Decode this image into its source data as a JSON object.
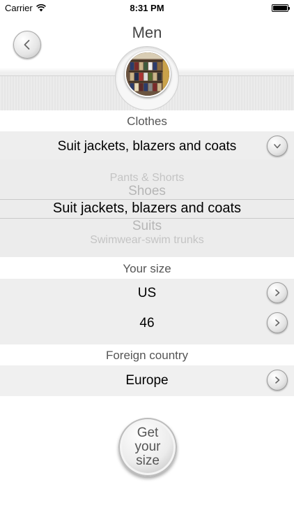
{
  "status_bar": {
    "carrier": "Carrier",
    "time": "8:31 PM",
    "battery_level": 1.0
  },
  "header": {
    "title": "Men"
  },
  "clothes_section": {
    "label": "Clothes",
    "selected": "Suit jackets, blazers and coats",
    "picker_options": [
      "Pants & Shorts",
      "Shoes",
      "Suit jackets, blazers and coats",
      "Suits",
      "Swimwear-swim trunks"
    ]
  },
  "size_section": {
    "label": "Your size",
    "system": "US",
    "value": "46"
  },
  "country_section": {
    "label": "Foreign country",
    "value": "Europe"
  },
  "get_size_button": {
    "line1": "Get",
    "line2": "your",
    "line3": "size"
  },
  "icons": {
    "back": "chevron-left-icon",
    "dropdown": "chevron-down-icon",
    "next": "chevron-right-icon",
    "wifi": "wifi-icon"
  }
}
